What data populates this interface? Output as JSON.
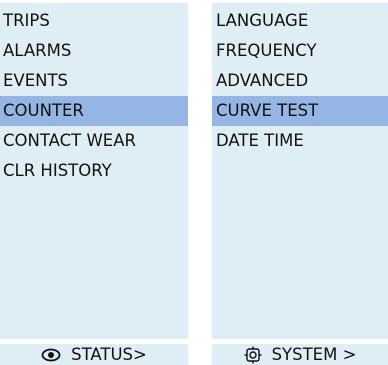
{
  "left_menu": {
    "items": [
      {
        "label": "TRIPS"
      },
      {
        "label": "ALARMS"
      },
      {
        "label": "EVENTS"
      },
      {
        "label": "COUNTER",
        "selected": true
      },
      {
        "label": "CONTACT WEAR"
      },
      {
        "label": "CLR HISTORY"
      }
    ],
    "footer": {
      "label": "STATUS>",
      "icon": "eye-icon"
    }
  },
  "right_menu": {
    "items": [
      {
        "label": "LANGUAGE"
      },
      {
        "label": "FREQUENCY"
      },
      {
        "label": "ADVANCED"
      },
      {
        "label": "CURVE TEST",
        "selected": true
      },
      {
        "label": "DATE TIME"
      }
    ],
    "footer": {
      "label": "SYSTEM >",
      "icon": "gear-icon"
    }
  },
  "colors": {
    "panel_background": "#dfeef5",
    "selected_highlight": "#95b6e4",
    "text": "#111111"
  }
}
